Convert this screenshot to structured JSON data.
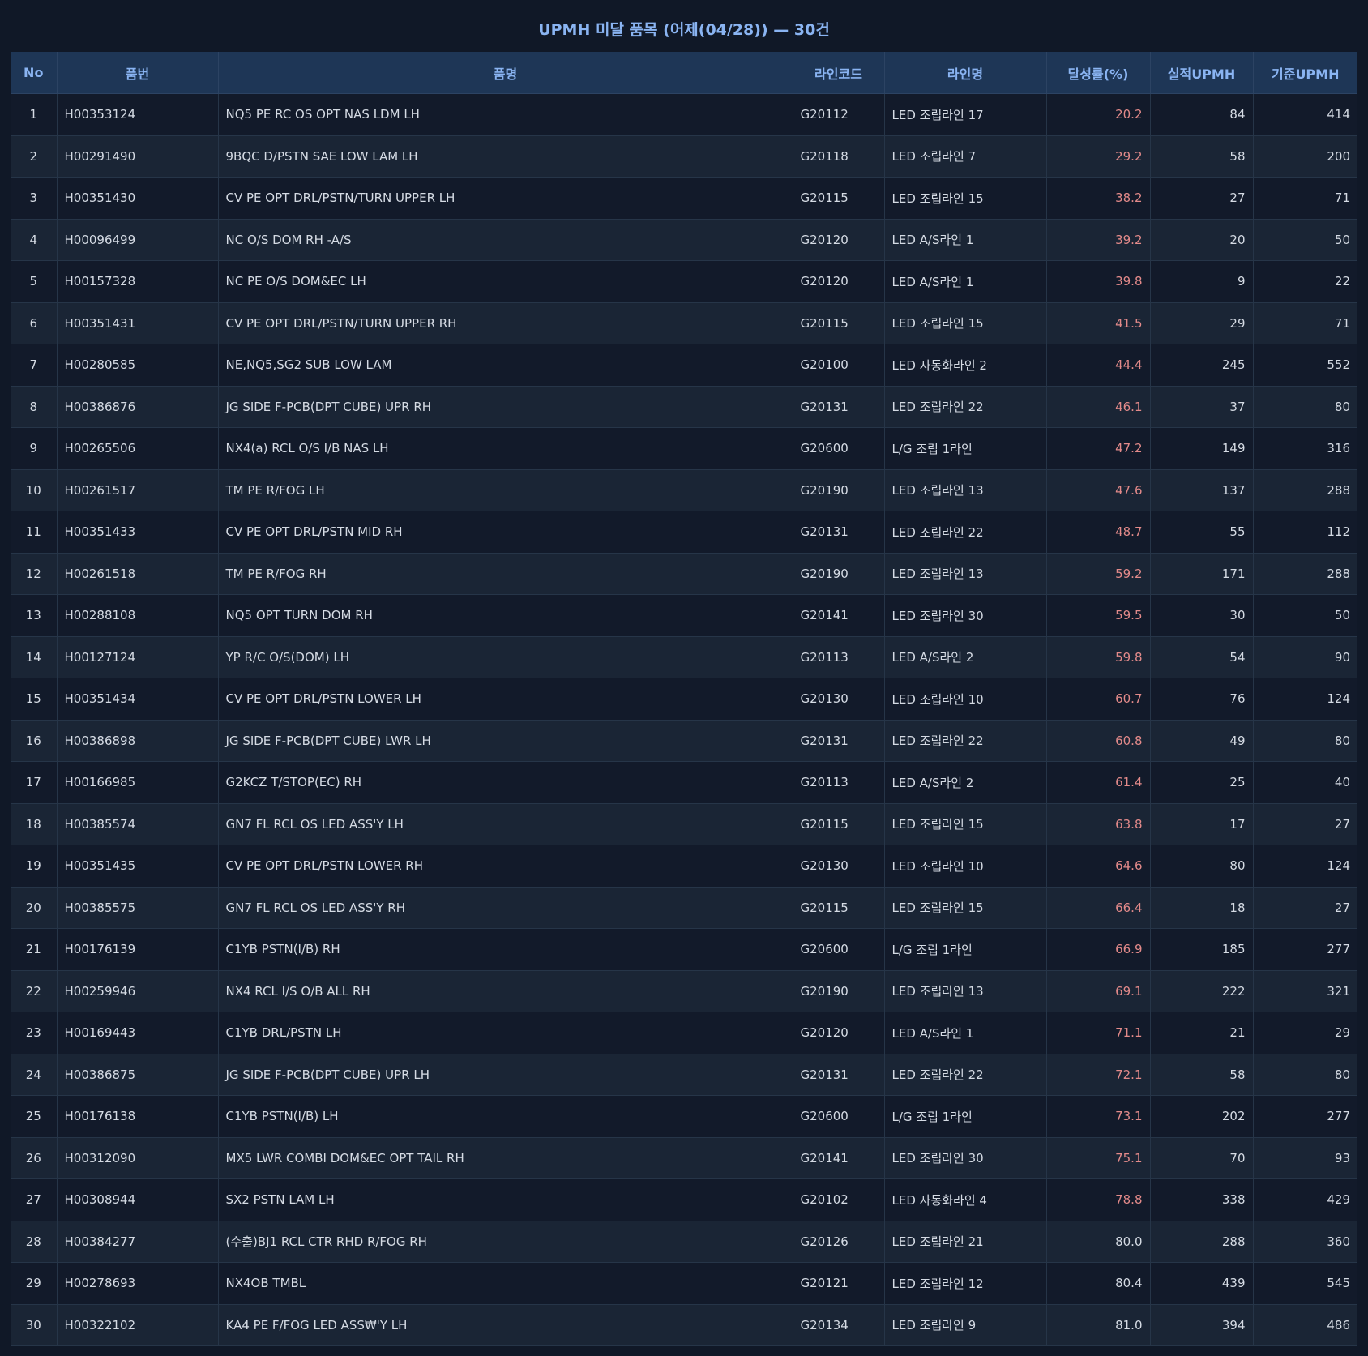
{
  "title": "UPMH 미달 품목 (어제(04/28)) — 30건",
  "columns": [
    "No",
    "품번",
    "품명",
    "라인코드",
    "라인명",
    "달성률(%)",
    "실적UPMH",
    "기준UPMH"
  ],
  "colors": {
    "background": "#101827",
    "header_bg": "#1e3656",
    "header_text": "#8ab4f2",
    "rate_low": "#e38a8a",
    "text": "#d5dbe4"
  },
  "rows": [
    {
      "no": "1",
      "part_no": "H00353124",
      "part_name": "NQ5 PE RC OS OPT NAS LDM LH",
      "line_code": "G20112",
      "line_name": "LED 조립라인 17",
      "rate": "20.2",
      "actual": "84",
      "standard": "414",
      "low": true
    },
    {
      "no": "2",
      "part_no": "H00291490",
      "part_name": "9BQC D/PSTN SAE LOW LAM LH",
      "line_code": "G20118",
      "line_name": "LED 조립라인 7",
      "rate": "29.2",
      "actual": "58",
      "standard": "200",
      "low": true
    },
    {
      "no": "3",
      "part_no": "H00351430",
      "part_name": "CV PE OPT DRL/PSTN/TURN UPPER LH",
      "line_code": "G20115",
      "line_name": "LED 조립라인 15",
      "rate": "38.2",
      "actual": "27",
      "standard": "71",
      "low": true
    },
    {
      "no": "4",
      "part_no": "H00096499",
      "part_name": "NC O/S DOM RH -A/S",
      "line_code": "G20120",
      "line_name": "LED A/S라인 1",
      "rate": "39.2",
      "actual": "20",
      "standard": "50",
      "low": true
    },
    {
      "no": "5",
      "part_no": "H00157328",
      "part_name": "NC PE O/S DOM&EC LH",
      "line_code": "G20120",
      "line_name": "LED A/S라인 1",
      "rate": "39.8",
      "actual": "9",
      "standard": "22",
      "low": true
    },
    {
      "no": "6",
      "part_no": "H00351431",
      "part_name": "CV PE OPT DRL/PSTN/TURN UPPER RH",
      "line_code": "G20115",
      "line_name": "LED 조립라인 15",
      "rate": "41.5",
      "actual": "29",
      "standard": "71",
      "low": true
    },
    {
      "no": "7",
      "part_no": "H00280585",
      "part_name": "NE,NQ5,SG2 SUB LOW LAM",
      "line_code": "G20100",
      "line_name": "LED 자동화라인 2",
      "rate": "44.4",
      "actual": "245",
      "standard": "552",
      "low": true
    },
    {
      "no": "8",
      "part_no": "H00386876",
      "part_name": "JG SIDE F-PCB(DPT CUBE) UPR RH",
      "line_code": "G20131",
      "line_name": "LED 조립라인 22",
      "rate": "46.1",
      "actual": "37",
      "standard": "80",
      "low": true
    },
    {
      "no": "9",
      "part_no": "H00265506",
      "part_name": "NX4(a) RCL O/S I/B NAS LH",
      "line_code": "G20600",
      "line_name": "L/G 조립 1라인",
      "rate": "47.2",
      "actual": "149",
      "standard": "316",
      "low": true
    },
    {
      "no": "10",
      "part_no": "H00261517",
      "part_name": "TM PE R/FOG LH",
      "line_code": "G20190",
      "line_name": "LED 조립라인 13",
      "rate": "47.6",
      "actual": "137",
      "standard": "288",
      "low": true
    },
    {
      "no": "11",
      "part_no": "H00351433",
      "part_name": "CV PE OPT DRL/PSTN MID RH",
      "line_code": "G20131",
      "line_name": "LED 조립라인 22",
      "rate": "48.7",
      "actual": "55",
      "standard": "112",
      "low": true
    },
    {
      "no": "12",
      "part_no": "H00261518",
      "part_name": "TM PE R/FOG RH",
      "line_code": "G20190",
      "line_name": "LED 조립라인 13",
      "rate": "59.2",
      "actual": "171",
      "standard": "288",
      "low": true
    },
    {
      "no": "13",
      "part_no": "H00288108",
      "part_name": "NQ5 OPT TURN DOM RH",
      "line_code": "G20141",
      "line_name": "LED 조립라인 30",
      "rate": "59.5",
      "actual": "30",
      "standard": "50",
      "low": true
    },
    {
      "no": "14",
      "part_no": "H00127124",
      "part_name": "YP R/C O/S(DOM) LH",
      "line_code": "G20113",
      "line_name": "LED A/S라인 2",
      "rate": "59.8",
      "actual": "54",
      "standard": "90",
      "low": true
    },
    {
      "no": "15",
      "part_no": "H00351434",
      "part_name": "CV PE OPT DRL/PSTN LOWER LH",
      "line_code": "G20130",
      "line_name": "LED 조립라인 10",
      "rate": "60.7",
      "actual": "76",
      "standard": "124",
      "low": true
    },
    {
      "no": "16",
      "part_no": "H00386898",
      "part_name": "JG SIDE F-PCB(DPT CUBE) LWR LH",
      "line_code": "G20131",
      "line_name": "LED 조립라인 22",
      "rate": "60.8",
      "actual": "49",
      "standard": "80",
      "low": true
    },
    {
      "no": "17",
      "part_no": "H00166985",
      "part_name": "G2KCZ T/STOP(EC) RH",
      "line_code": "G20113",
      "line_name": "LED A/S라인 2",
      "rate": "61.4",
      "actual": "25",
      "standard": "40",
      "low": true
    },
    {
      "no": "18",
      "part_no": "H00385574",
      "part_name": "GN7 FL RCL OS LED ASS'Y LH",
      "line_code": "G20115",
      "line_name": "LED 조립라인 15",
      "rate": "63.8",
      "actual": "17",
      "standard": "27",
      "low": true
    },
    {
      "no": "19",
      "part_no": "H00351435",
      "part_name": "CV PE OPT DRL/PSTN LOWER RH",
      "line_code": "G20130",
      "line_name": "LED 조립라인 10",
      "rate": "64.6",
      "actual": "80",
      "standard": "124",
      "low": true
    },
    {
      "no": "20",
      "part_no": "H00385575",
      "part_name": "GN7 FL RCL OS LED ASS'Y RH",
      "line_code": "G20115",
      "line_name": "LED 조립라인 15",
      "rate": "66.4",
      "actual": "18",
      "standard": "27",
      "low": true
    },
    {
      "no": "21",
      "part_no": "H00176139",
      "part_name": "C1YB PSTN(I/B) RH",
      "line_code": "G20600",
      "line_name": "L/G 조립 1라인",
      "rate": "66.9",
      "actual": "185",
      "standard": "277",
      "low": true
    },
    {
      "no": "22",
      "part_no": "H00259946",
      "part_name": "NX4 RCL I/S O/B ALL RH",
      "line_code": "G20190",
      "line_name": "LED 조립라인 13",
      "rate": "69.1",
      "actual": "222",
      "standard": "321",
      "low": true
    },
    {
      "no": "23",
      "part_no": "H00169443",
      "part_name": "C1YB DRL/PSTN LH",
      "line_code": "G20120",
      "line_name": "LED A/S라인 1",
      "rate": "71.1",
      "actual": "21",
      "standard": "29",
      "low": true
    },
    {
      "no": "24",
      "part_no": "H00386875",
      "part_name": "JG SIDE F-PCB(DPT CUBE) UPR LH",
      "line_code": "G20131",
      "line_name": "LED 조립라인 22",
      "rate": "72.1",
      "actual": "58",
      "standard": "80",
      "low": true
    },
    {
      "no": "25",
      "part_no": "H00176138",
      "part_name": "C1YB PSTN(I/B) LH",
      "line_code": "G20600",
      "line_name": "L/G 조립 1라인",
      "rate": "73.1",
      "actual": "202",
      "standard": "277",
      "low": true
    },
    {
      "no": "26",
      "part_no": "H00312090",
      "part_name": "MX5 LWR COMBI DOM&EC OPT TAIL RH",
      "line_code": "G20141",
      "line_name": "LED 조립라인 30",
      "rate": "75.1",
      "actual": "70",
      "standard": "93",
      "low": true
    },
    {
      "no": "27",
      "part_no": "H00308944",
      "part_name": "SX2 PSTN LAM LH",
      "line_code": "G20102",
      "line_name": "LED 자동화라인 4",
      "rate": "78.8",
      "actual": "338",
      "standard": "429",
      "low": true
    },
    {
      "no": "28",
      "part_no": "H00384277",
      "part_name": "(수출)BJ1 RCL CTR RHD R/FOG RH",
      "line_code": "G20126",
      "line_name": "LED 조립라인 21",
      "rate": "80.0",
      "actual": "288",
      "standard": "360",
      "low": false
    },
    {
      "no": "29",
      "part_no": "H00278693",
      "part_name": "NX4OB TMBL",
      "line_code": "G20121",
      "line_name": "LED 조립라인 12",
      "rate": "80.4",
      "actual": "439",
      "standard": "545",
      "low": false
    },
    {
      "no": "30",
      "part_no": "H00322102",
      "part_name": "KA4 PE F/FOG LED ASS₩'Y LH",
      "line_code": "G20134",
      "line_name": "LED 조립라인 9",
      "rate": "81.0",
      "actual": "394",
      "standard": "486",
      "low": false
    }
  ]
}
